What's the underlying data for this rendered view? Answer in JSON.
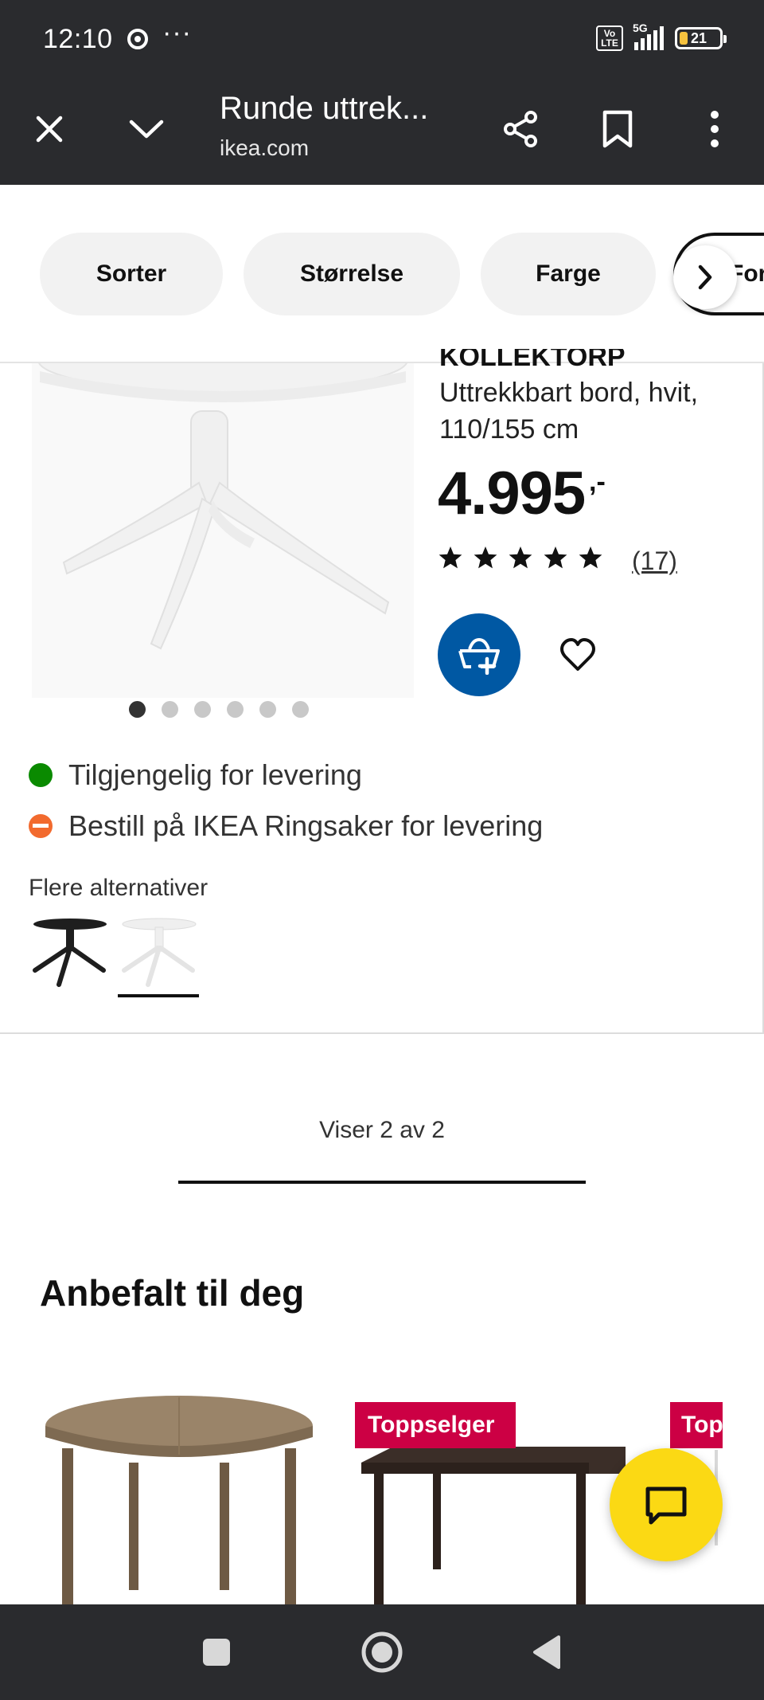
{
  "status_bar": {
    "time": "12:10",
    "more": "···",
    "volte": "Vo LTE",
    "network": "5G",
    "battery": "21"
  },
  "browser": {
    "title": "Runde uttrek...",
    "url": "ikea.com"
  },
  "filters": {
    "pills": [
      "Sorter",
      "Størrelse",
      "Farge"
    ],
    "partial_pill": "For"
  },
  "product": {
    "name_cut": "KOLLEKTORP",
    "description": "Uttrekkbart bord, hvit, 110/155 cm",
    "price": "4.995",
    "price_suffix": ",-",
    "rating": 5,
    "review_count": "(17)",
    "image_count": 6,
    "active_image": 1,
    "availability": [
      {
        "status": "green",
        "text": "Tilgjengelig for levering"
      },
      {
        "status": "orange",
        "text": "Bestill på IKEA Ringsaker for levering"
      }
    ],
    "alternatives_label": "Flere alternativer",
    "alternatives": [
      {
        "color_name": "black-brown",
        "color": "#1e1e1e",
        "selected": false
      },
      {
        "color_name": "white",
        "color": "#f4f4f4",
        "selected": true
      }
    ]
  },
  "pagination": {
    "text": "Viser 2 av 2",
    "progress_fraction": 1.0
  },
  "recommended": {
    "title": "Anbefalt til deg",
    "badges": [
      "Toppselger",
      "Top"
    ]
  },
  "colors": {
    "ikea_blue": "#0058a3",
    "chat_yellow": "#fbd914",
    "badge_red": "#cc0044",
    "chrome_dark": "#2a2b2e"
  }
}
